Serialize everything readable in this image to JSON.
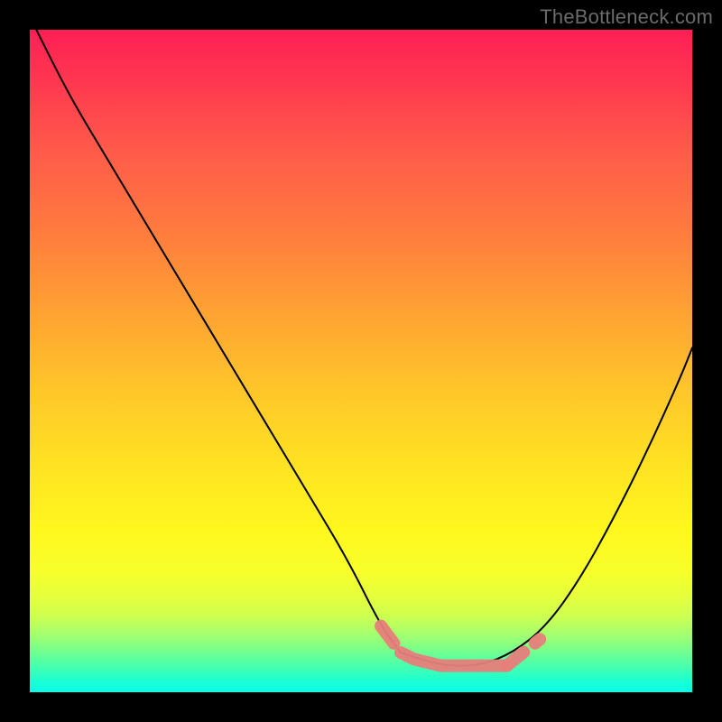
{
  "watermark": "TheBottleneck.com",
  "chart_data": {
    "type": "line",
    "title": "",
    "xlabel": "",
    "ylabel": "",
    "xlim": [
      0,
      100
    ],
    "ylim": [
      0,
      100
    ],
    "grid": false,
    "legend": false,
    "series": [
      {
        "name": "bottleneck-curve-left",
        "x": [
          1,
          6,
          12,
          18,
          24,
          30,
          36,
          42,
          48,
          53,
          56
        ],
        "values": [
          100,
          90,
          80,
          70,
          60,
          50,
          40,
          30,
          20,
          10,
          6
        ]
      },
      {
        "name": "bottleneck-curve-right",
        "x": [
          56,
          62,
          68,
          73,
          78,
          83,
          88,
          93,
          98,
          100
        ],
        "values": [
          6,
          4,
          4,
          6,
          10,
          17,
          26,
          36,
          47,
          52
        ]
      },
      {
        "name": "optimal-band",
        "x": [
          53,
          56,
          58,
          62,
          68,
          72,
          77
        ],
        "values": [
          10,
          6,
          5,
          4,
          4,
          4,
          8
        ]
      }
    ],
    "annotations": [
      {
        "text": "TheBottleneck.com",
        "position": "top-right",
        "color": "#6b6b6b"
      }
    ],
    "background_gradient": {
      "top": "#ff1f55",
      "bottom": "#08ffe8",
      "stops": [
        "red",
        "orange",
        "yellow",
        "green"
      ]
    }
  }
}
